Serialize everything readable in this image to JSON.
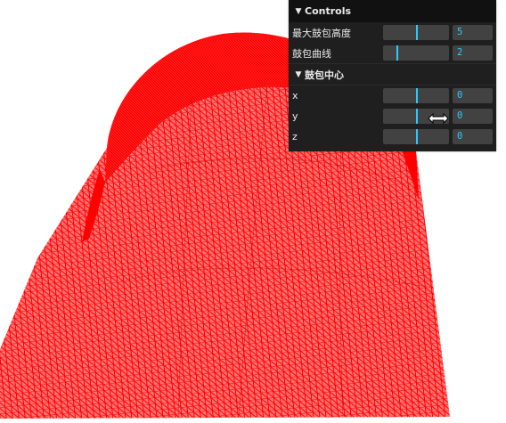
{
  "scene": {
    "mesh_color": "#ff0000",
    "background": "#ffffff"
  },
  "gui": {
    "title": "Controls",
    "controls": [
      {
        "label": "最大鼓包高度",
        "value": "5",
        "fraction": 0.52
      },
      {
        "label": "鼓包曲线",
        "value": "2",
        "fraction": 0.21
      }
    ],
    "folder": {
      "title": "鼓包中心",
      "controls": [
        {
          "label": "x",
          "value": "0",
          "fraction": 0.52
        },
        {
          "label": "y",
          "value": "0",
          "fraction": 0.52
        },
        {
          "label": "z",
          "value": "0",
          "fraction": 0.52
        }
      ]
    },
    "accent": "#2cc9ff"
  },
  "icons": {
    "collapse": "chevron-down-icon",
    "cursor": "ew-resize-cursor-icon"
  }
}
